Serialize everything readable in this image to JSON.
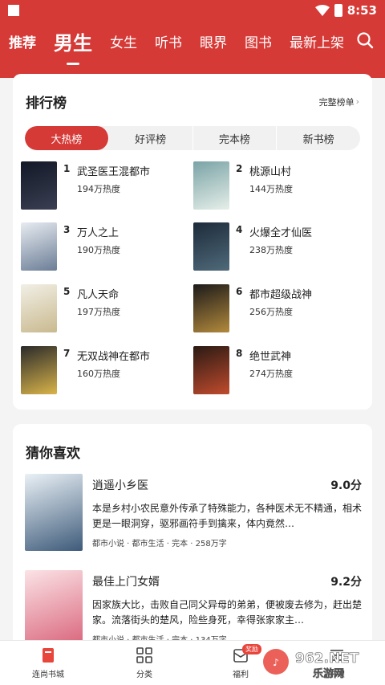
{
  "status": {
    "time": "8:53"
  },
  "nav": {
    "tabs": [
      "推荐",
      "男生",
      "女生",
      "听书",
      "眼界",
      "图书",
      "最新上架"
    ],
    "active_index": 1
  },
  "ranking": {
    "title": "排行榜",
    "more_label": "完整榜单",
    "segments": [
      "大热榜",
      "好评榜",
      "完本榜",
      "新书榜"
    ],
    "active_segment": 0,
    "items": [
      {
        "rank": "1",
        "name": "武圣医王混都市",
        "heat": "194万热度",
        "cover_colors": [
          "#121826",
          "#3a3f52"
        ]
      },
      {
        "rank": "2",
        "name": "桃源山村",
        "heat": "144万热度",
        "cover_colors": [
          "#7aa3a6",
          "#e6efe9"
        ]
      },
      {
        "rank": "3",
        "name": "万人之上",
        "heat": "190万热度",
        "cover_colors": [
          "#e8ecf1",
          "#6b7d96"
        ]
      },
      {
        "rank": "4",
        "name": "火爆全才仙医",
        "heat": "238万热度",
        "cover_colors": [
          "#1d2b3a",
          "#4f6a7a"
        ]
      },
      {
        "rank": "5",
        "name": "凡人天命",
        "heat": "197万热度",
        "cover_colors": [
          "#f1efe6",
          "#c9b98e"
        ]
      },
      {
        "rank": "6",
        "name": "都市超级战神",
        "heat": "256万热度",
        "cover_colors": [
          "#1c1a1a",
          "#b38a3c"
        ]
      },
      {
        "rank": "7",
        "name": "无双战神在都市",
        "heat": "160万热度",
        "cover_colors": [
          "#2a2a2a",
          "#d9b44a"
        ]
      },
      {
        "rank": "8",
        "name": "绝世武神",
        "heat": "274万热度",
        "cover_colors": [
          "#2a1a14",
          "#c04b2d"
        ]
      }
    ]
  },
  "guess": {
    "title": "猜你喜欢",
    "items": [
      {
        "name": "逍遥小乡医",
        "score": "9.0分",
        "desc": "本是乡村小农民意外传承了特殊能力，各种医术无不精通，相术更是一眼洞穿，驱邪画符手到擒来，体内竟然…",
        "meta": "都市小说 · 都市生活 · 完本 · 258万字",
        "cover_colors": [
          "#eaf1f6",
          "#3e5b7a"
        ]
      },
      {
        "name": "最佳上门女婿",
        "score": "9.2分",
        "desc": "因家族大比，击败自己同父异母的弟弟，便被废去修为，赶出楚家。流落街头的楚风，险些身死，幸得张家家主…",
        "meta": "都市小说 · 都市生活 · 完本 · 134万字",
        "cover_colors": [
          "#fbe3e6",
          "#d9637a"
        ]
      }
    ]
  },
  "bottom_nav": {
    "items": [
      "连尚书城",
      "分类",
      "福利",
      "书架"
    ],
    "badge": "奖励"
  },
  "watermark": {
    "text": "962.NET",
    "sub": "乐游网"
  },
  "colors": {
    "brand": "#d63a37"
  }
}
